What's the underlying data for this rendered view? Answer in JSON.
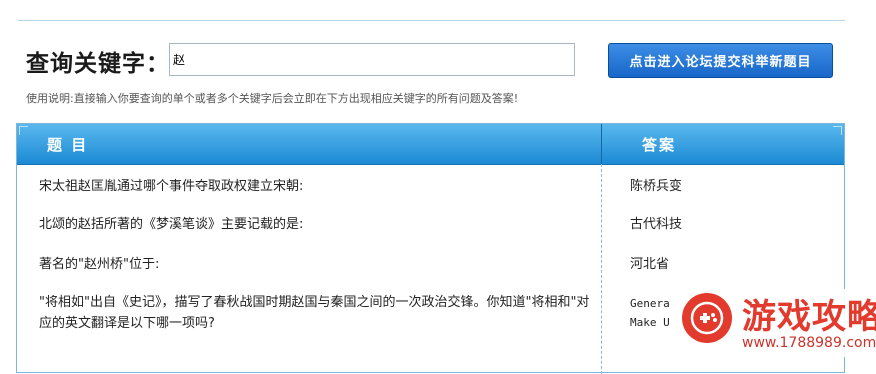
{
  "search": {
    "label": "查询关键字：",
    "value": "赵",
    "button_label": "点击进入论坛提交科举新题目",
    "usage_note": "使用说明:直接输入你要查询的单个或者多个关键字后会立即在下方出现相应关键字的所有问题及答案!"
  },
  "table": {
    "header_question": "题 目",
    "header_answer": "答案",
    "rows": [
      {
        "question": "宋太祖赵匡胤通过哪个事件夺取政权建立宋朝:",
        "answer": "陈桥兵变"
      },
      {
        "question": "北颂的赵括所著的《梦溪笔谈》主要记载的是:",
        "answer": "古代科技"
      },
      {
        "question": "著名的\"赵州桥\"位于:",
        "answer": "河北省"
      },
      {
        "question": "\"将相如\"出自《史记》，描写了春秋战国时期赵国与秦国之间的一次政治交锋。你知道\"将相和\"对应的英文翻译是以下哪一项吗?",
        "answer_line1": "Genera",
        "answer_line2": "Make U"
      }
    ]
  },
  "watermark": {
    "title": "游戏攻略",
    "url": "www.1788989.com"
  }
}
